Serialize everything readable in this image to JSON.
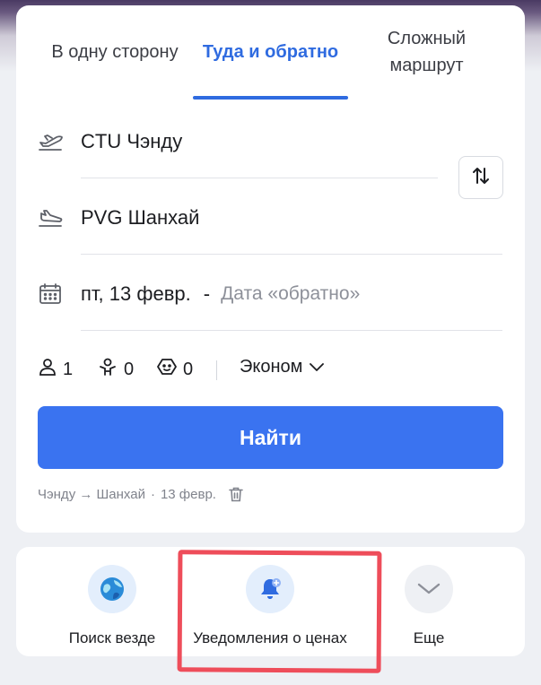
{
  "tabs": [
    {
      "label": "В одну сторону"
    },
    {
      "label": "Туда и обратно",
      "active": true
    },
    {
      "label_line1": "Сложный",
      "label_line2": "маршрут"
    }
  ],
  "route": {
    "origin": "CTU Чэнду",
    "destination": "PVG Шанхай"
  },
  "dates": {
    "departure": "пт, 13 февр.",
    "separator": "-",
    "return_placeholder": "Дата «обратно»"
  },
  "passengers": {
    "adults": "1",
    "children": "0",
    "infants": "0",
    "cabin_class": "Эконом"
  },
  "search_button": "Найти",
  "recent_search": {
    "route": "Чэнду → Шанхай",
    "dot": "·",
    "date": "13 февр."
  },
  "quick_actions": [
    {
      "label": "Поиск везде",
      "icon": "globe-icon"
    },
    {
      "label": "Уведомления о ценах",
      "icon": "bell-plus-icon"
    },
    {
      "label": "Еще",
      "icon": "chevron-down-icon"
    }
  ],
  "colors": {
    "accent": "#2f6be0",
    "button": "#3a73f0",
    "highlight": "#ee4d5a"
  }
}
